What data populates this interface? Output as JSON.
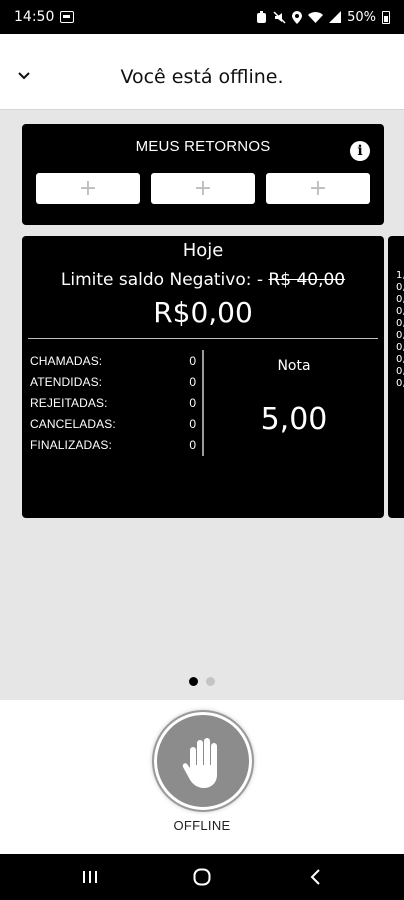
{
  "status_bar": {
    "time": "14:50",
    "battery": "50%"
  },
  "header": {
    "title": "Você está offline."
  },
  "returns": {
    "title": "MEUS RETORNOS",
    "buttons": [
      "+",
      "+",
      "+"
    ]
  },
  "stats": {
    "day": "Hoje",
    "limit_label": "Limite saldo Negativo: - ",
    "limit_value": "R$ 40,00",
    "balance": "R$0,00",
    "rows": [
      {
        "label": "CHAMADAS:",
        "value": "0"
      },
      {
        "label": "ATENDIDAS:",
        "value": "0"
      },
      {
        "label": "REJEITADAS:",
        "value": "0"
      },
      {
        "label": "CANCELADAS:",
        "value": "0"
      },
      {
        "label": "FINALIZADAS:",
        "value": "0"
      }
    ],
    "nota_label": "Nota",
    "nota_value": "5,00"
  },
  "peek_card": {
    "values": [
      "1,",
      "0,",
      "0,",
      "0,",
      "0,",
      "0,",
      "0,",
      "0,",
      "0,",
      "0,"
    ]
  },
  "pager": {
    "total": 2,
    "active": 0
  },
  "offline_button": {
    "label": "OFFLINE",
    "icon": "hand-stop-icon"
  },
  "colors": {
    "card_bg": "#000000",
    "page_bg": "#e6e6e6",
    "button_gray": "#8c8c8c"
  }
}
